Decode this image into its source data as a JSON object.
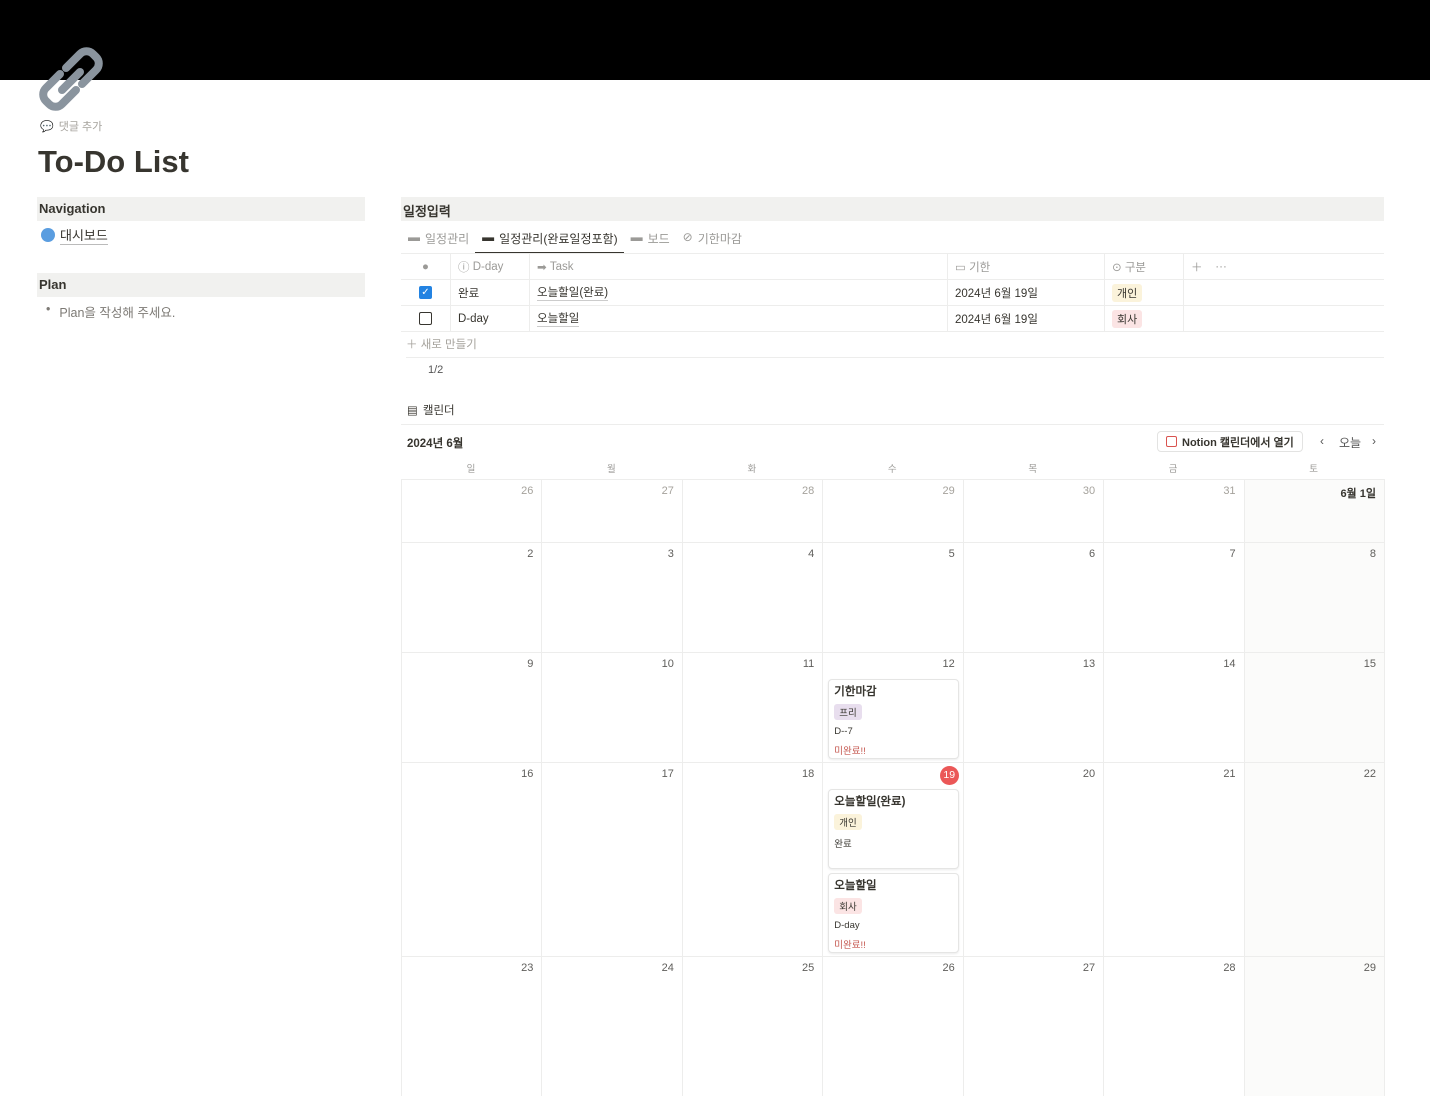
{
  "page": {
    "title": "To-Do List",
    "add_comment": "댓글 추가",
    "icon": "link-icon"
  },
  "navigation": {
    "heading": "Navigation",
    "link": "대시보드"
  },
  "plan": {
    "heading": "Plan",
    "item": "Plan을 작성해 주세요."
  },
  "schedule": {
    "heading": "일정입력",
    "tabs": [
      {
        "label": "일정관리",
        "active": false,
        "icon": "calendar-icon"
      },
      {
        "label": "일정관리(완료일정포함)",
        "active": true,
        "icon": "calendar-icon"
      },
      {
        "label": "보드",
        "active": false,
        "icon": "calendar-icon"
      },
      {
        "label": "기한마감",
        "active": false,
        "icon": "eye-off-icon"
      }
    ],
    "columns": {
      "dday": "D-day",
      "task": "Task",
      "due": "기한",
      "category": "구분"
    },
    "rows": [
      {
        "checked": true,
        "dday": "완료",
        "task": "오늘할일(완료)",
        "due": "2024년 6월 19일",
        "category": "개인",
        "category_color": "#fbf3db"
      },
      {
        "checked": false,
        "dday": "D-day",
        "task": "오늘할일",
        "due": "2024년 6월 19일",
        "category": "회사",
        "category_color": "#fbe4e4"
      }
    ],
    "new_label": "새로 만들기",
    "count": "1/2"
  },
  "calendar": {
    "view_label": "캘린더",
    "month": "2024년 6월",
    "open_button": "Notion 캘린더에서 열기",
    "today_button": "오늘",
    "weekdays": [
      "일",
      "월",
      "화",
      "수",
      "목",
      "금",
      "토"
    ],
    "weeks": [
      [
        "26",
        "27",
        "28",
        "29",
        "30",
        "31",
        "6월 1일"
      ],
      [
        "2",
        "3",
        "4",
        "5",
        "6",
        "7",
        "8"
      ],
      [
        "9",
        "10",
        "11",
        "12",
        "13",
        "14",
        "15"
      ],
      [
        "16",
        "17",
        "18",
        "19",
        "20",
        "21",
        "22"
      ],
      [
        "23",
        "24",
        "25",
        "26",
        "27",
        "28",
        "29"
      ]
    ],
    "today": "19",
    "events": [
      {
        "week": 2,
        "day": 3,
        "title": "기한마감",
        "tag": "프리",
        "tag_color": "#e8deee",
        "line": "D--7",
        "status": "미완료!!"
      },
      {
        "week": 3,
        "day": 3,
        "title": "오늘할일(완료)",
        "tag": "개인",
        "tag_color": "#fbf3db",
        "line": "완료",
        "status": ""
      },
      {
        "week": 3,
        "day": 3,
        "title": "오늘할일",
        "tag": "회사",
        "tag_color": "#fbe4e4",
        "line": "D-day",
        "status": "미완료!!"
      }
    ]
  }
}
